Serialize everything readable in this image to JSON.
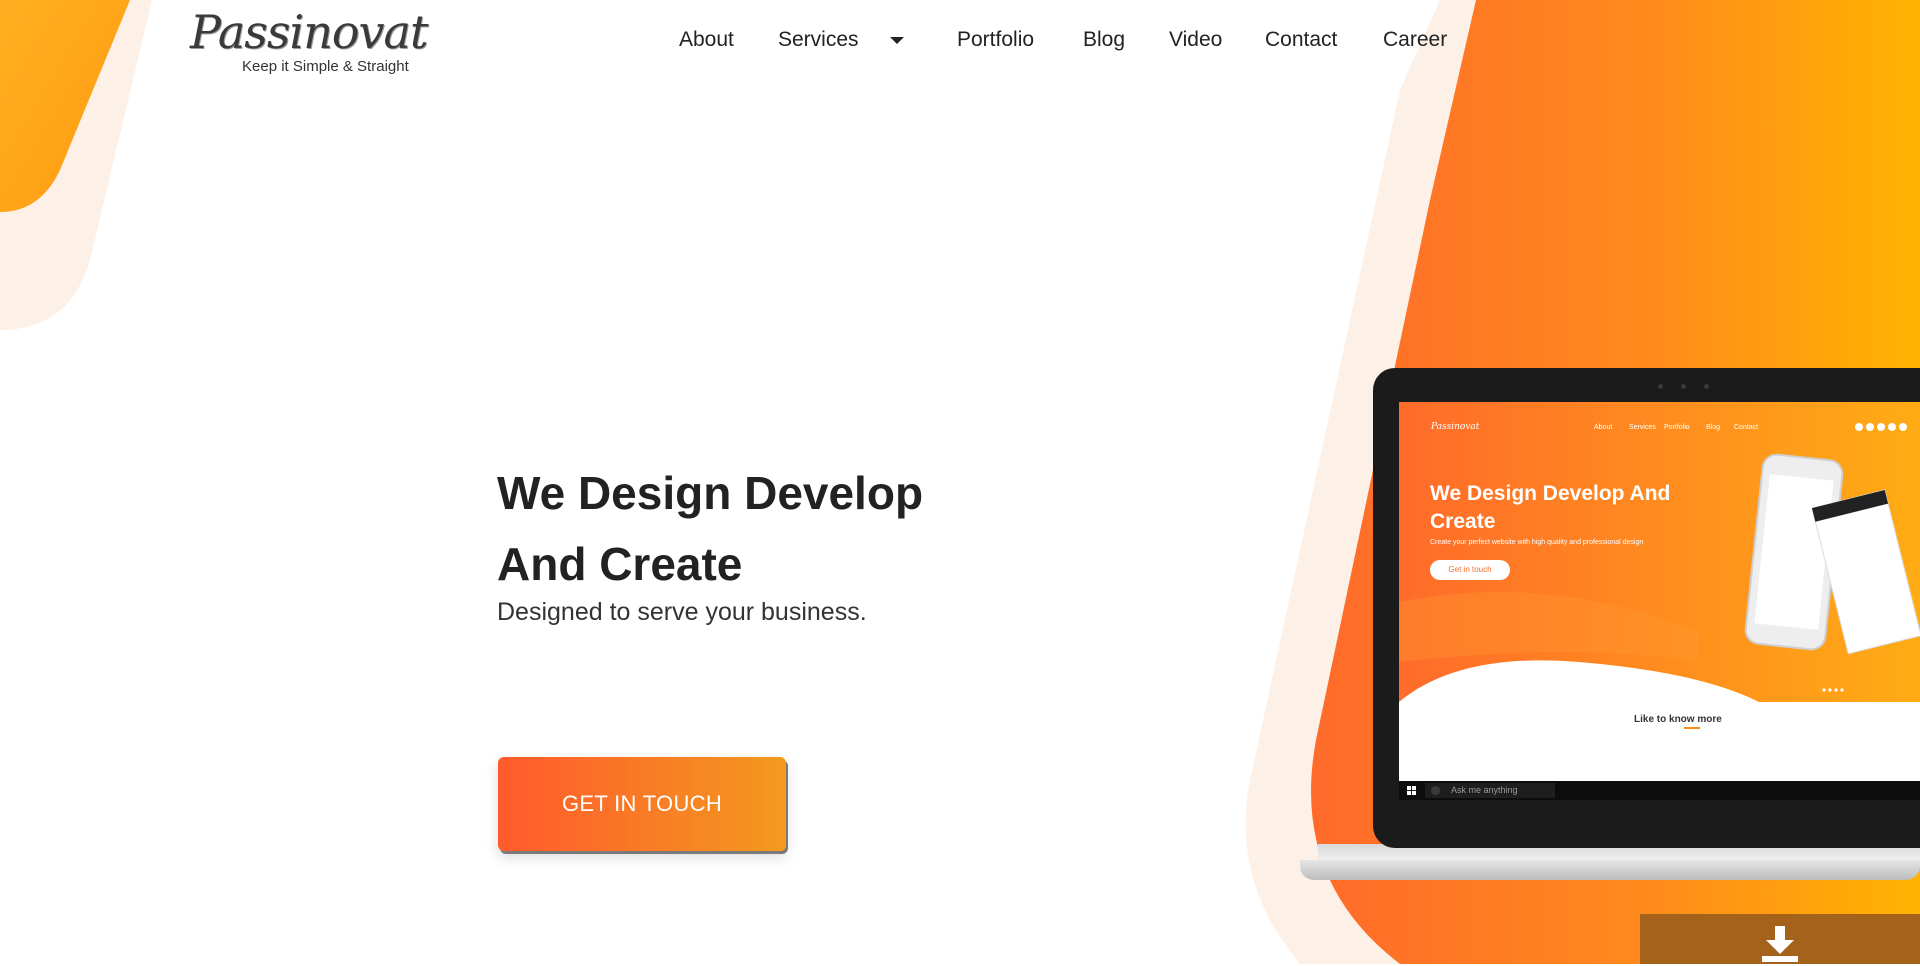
{
  "colors": {
    "accent_orange": "#ff7a1f",
    "accent_yellow": "#ffb300",
    "cta_start": "#ff5a2c",
    "cta_end": "#f39a1f",
    "cream": "#fdf0e6",
    "download_bg": "#a4621a"
  },
  "brand": {
    "name": "Passinovat",
    "tagline": "Keep it Simple & Straight"
  },
  "nav": {
    "items": [
      "About",
      "Services",
      "Portfolio",
      "Blog",
      "Video",
      "Contact",
      "Career"
    ],
    "services_icon": "caret-down-icon"
  },
  "hero": {
    "title": "We Design Develop And Create",
    "subtitle": "Designed to serve your business.",
    "cta_label": "GET IN TOUCH"
  },
  "mockup": {
    "brand": "Passinovat",
    "nav": [
      "About",
      "Services",
      "Portfolio",
      "Blog",
      "Contact"
    ],
    "title": "We Design Develop And Create",
    "subtitle": "Create your perfect website with high quality and professional design",
    "cta_label": "Get in touch",
    "more_label": "Like to know more",
    "taskbar_search": "Ask me anything"
  },
  "download": {
    "icon": "download-icon"
  }
}
